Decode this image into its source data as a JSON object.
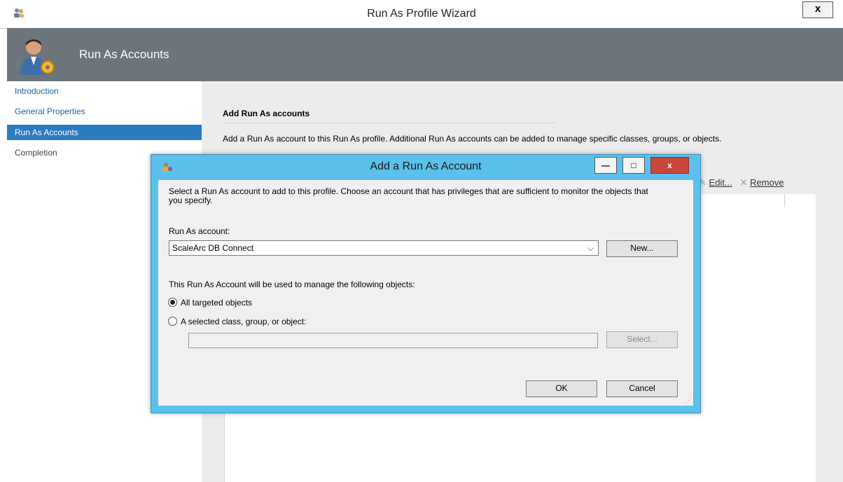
{
  "window": {
    "title": "Run As Profile Wizard",
    "close_label": "x"
  },
  "header": {
    "title": "Run As Accounts"
  },
  "nav": {
    "items": [
      {
        "label": "Introduction"
      },
      {
        "label": "General Properties"
      },
      {
        "label": "Run As Accounts"
      },
      {
        "label": "Completion"
      }
    ],
    "selected": "Run As Accounts"
  },
  "pane": {
    "heading": "Add Run As accounts",
    "description": "Add a Run As account to this Run As profile.  Additional Run As accounts can be added to manage specific classes, groups, or objects.",
    "toolbar": {
      "edit_label": "Edit...",
      "remove_label": "Remove"
    }
  },
  "dialog": {
    "title": "Add a Run As Account",
    "description": "Select a Run As account to add to this profile.  Choose an account that has privileges that are sufficient to monitor the objects that you specify.",
    "account_label": "Run As account:",
    "account_value": "ScaleArc DB Connect",
    "new_button": "New...",
    "objects_label": "This Run As Account will be used to manage the following objects:",
    "radio_all": "All targeted objects",
    "radio_selected": "A selected class, group, or object:",
    "selected_option": "All targeted objects",
    "object_value": "",
    "select_button": "Select...",
    "ok_button": "OK",
    "cancel_button": "Cancel",
    "window_buttons": {
      "minimize": "—",
      "maximize": "□",
      "close": "x"
    }
  },
  "colors": {
    "header_band": "#6c747c",
    "nav_selected": "#2b7bc0",
    "dialog_frame": "#5bc1ec",
    "close_red": "#c9463d"
  }
}
